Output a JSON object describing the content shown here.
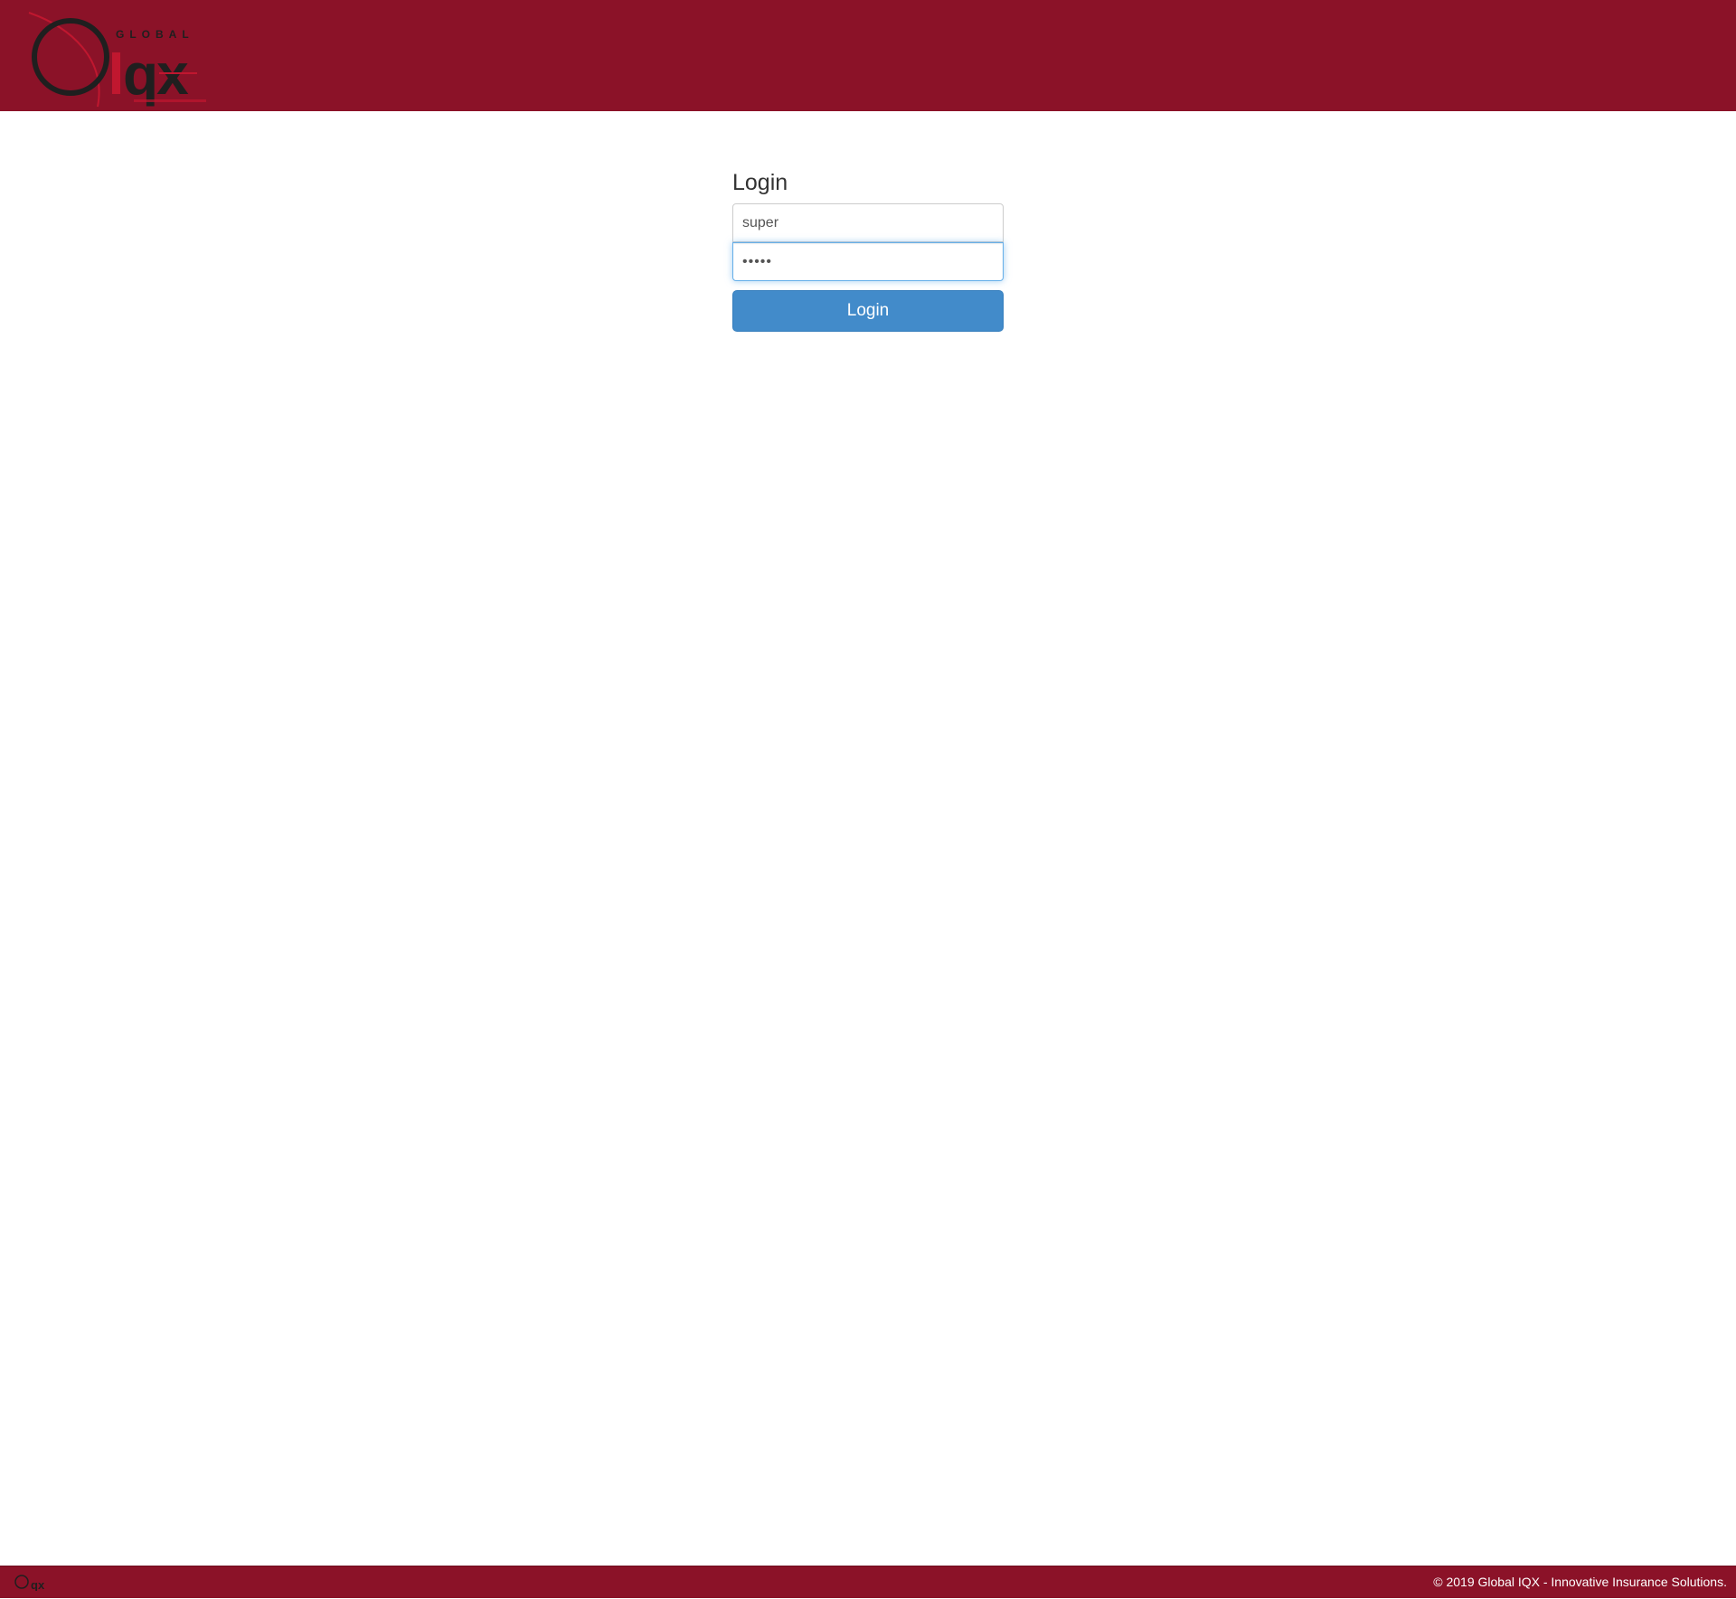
{
  "header": {
    "logo": {
      "name": "Global IQX logo",
      "text_top": "GLOBAL",
      "text_main": "iqx"
    }
  },
  "login": {
    "heading": "Login",
    "username_value": "super",
    "password_value": "•••••",
    "button_label": "Login"
  },
  "footer": {
    "logo": {
      "name": "iqx logo small",
      "text": "qx"
    },
    "copyright": "© 2019 Global IQX - Innovative Insurance Solutions."
  },
  "colors": {
    "brand": "#8b1228",
    "button": "#428bca",
    "focus": "#66afe9"
  }
}
